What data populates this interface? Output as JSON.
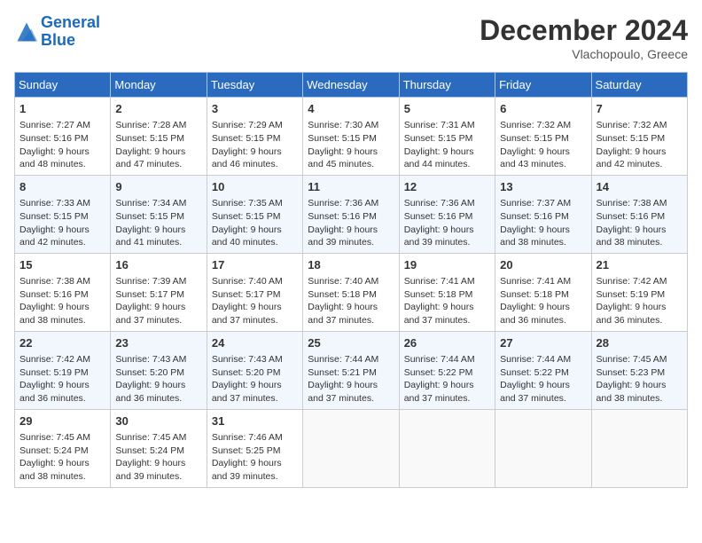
{
  "header": {
    "logo_line1": "General",
    "logo_line2": "Blue",
    "month": "December 2024",
    "location": "Vlachopoulo, Greece"
  },
  "weekdays": [
    "Sunday",
    "Monday",
    "Tuesday",
    "Wednesday",
    "Thursday",
    "Friday",
    "Saturday"
  ],
  "weeks": [
    [
      {
        "day": "1",
        "lines": [
          "Sunrise: 7:27 AM",
          "Sunset: 5:16 PM",
          "Daylight: 9 hours",
          "and 48 minutes."
        ]
      },
      {
        "day": "2",
        "lines": [
          "Sunrise: 7:28 AM",
          "Sunset: 5:15 PM",
          "Daylight: 9 hours",
          "and 47 minutes."
        ]
      },
      {
        "day": "3",
        "lines": [
          "Sunrise: 7:29 AM",
          "Sunset: 5:15 PM",
          "Daylight: 9 hours",
          "and 46 minutes."
        ]
      },
      {
        "day": "4",
        "lines": [
          "Sunrise: 7:30 AM",
          "Sunset: 5:15 PM",
          "Daylight: 9 hours",
          "and 45 minutes."
        ]
      },
      {
        "day": "5",
        "lines": [
          "Sunrise: 7:31 AM",
          "Sunset: 5:15 PM",
          "Daylight: 9 hours",
          "and 44 minutes."
        ]
      },
      {
        "day": "6",
        "lines": [
          "Sunrise: 7:32 AM",
          "Sunset: 5:15 PM",
          "Daylight: 9 hours",
          "and 43 minutes."
        ]
      },
      {
        "day": "7",
        "lines": [
          "Sunrise: 7:32 AM",
          "Sunset: 5:15 PM",
          "Daylight: 9 hours",
          "and 42 minutes."
        ]
      }
    ],
    [
      {
        "day": "8",
        "lines": [
          "Sunrise: 7:33 AM",
          "Sunset: 5:15 PM",
          "Daylight: 9 hours",
          "and 42 minutes."
        ]
      },
      {
        "day": "9",
        "lines": [
          "Sunrise: 7:34 AM",
          "Sunset: 5:15 PM",
          "Daylight: 9 hours",
          "and 41 minutes."
        ]
      },
      {
        "day": "10",
        "lines": [
          "Sunrise: 7:35 AM",
          "Sunset: 5:15 PM",
          "Daylight: 9 hours",
          "and 40 minutes."
        ]
      },
      {
        "day": "11",
        "lines": [
          "Sunrise: 7:36 AM",
          "Sunset: 5:16 PM",
          "Daylight: 9 hours",
          "and 39 minutes."
        ]
      },
      {
        "day": "12",
        "lines": [
          "Sunrise: 7:36 AM",
          "Sunset: 5:16 PM",
          "Daylight: 9 hours",
          "and 39 minutes."
        ]
      },
      {
        "day": "13",
        "lines": [
          "Sunrise: 7:37 AM",
          "Sunset: 5:16 PM",
          "Daylight: 9 hours",
          "and 38 minutes."
        ]
      },
      {
        "day": "14",
        "lines": [
          "Sunrise: 7:38 AM",
          "Sunset: 5:16 PM",
          "Daylight: 9 hours",
          "and 38 minutes."
        ]
      }
    ],
    [
      {
        "day": "15",
        "lines": [
          "Sunrise: 7:38 AM",
          "Sunset: 5:16 PM",
          "Daylight: 9 hours",
          "and 38 minutes."
        ]
      },
      {
        "day": "16",
        "lines": [
          "Sunrise: 7:39 AM",
          "Sunset: 5:17 PM",
          "Daylight: 9 hours",
          "and 37 minutes."
        ]
      },
      {
        "day": "17",
        "lines": [
          "Sunrise: 7:40 AM",
          "Sunset: 5:17 PM",
          "Daylight: 9 hours",
          "and 37 minutes."
        ]
      },
      {
        "day": "18",
        "lines": [
          "Sunrise: 7:40 AM",
          "Sunset: 5:18 PM",
          "Daylight: 9 hours",
          "and 37 minutes."
        ]
      },
      {
        "day": "19",
        "lines": [
          "Sunrise: 7:41 AM",
          "Sunset: 5:18 PM",
          "Daylight: 9 hours",
          "and 37 minutes."
        ]
      },
      {
        "day": "20",
        "lines": [
          "Sunrise: 7:41 AM",
          "Sunset: 5:18 PM",
          "Daylight: 9 hours",
          "and 36 minutes."
        ]
      },
      {
        "day": "21",
        "lines": [
          "Sunrise: 7:42 AM",
          "Sunset: 5:19 PM",
          "Daylight: 9 hours",
          "and 36 minutes."
        ]
      }
    ],
    [
      {
        "day": "22",
        "lines": [
          "Sunrise: 7:42 AM",
          "Sunset: 5:19 PM",
          "Daylight: 9 hours",
          "and 36 minutes."
        ]
      },
      {
        "day": "23",
        "lines": [
          "Sunrise: 7:43 AM",
          "Sunset: 5:20 PM",
          "Daylight: 9 hours",
          "and 36 minutes."
        ]
      },
      {
        "day": "24",
        "lines": [
          "Sunrise: 7:43 AM",
          "Sunset: 5:20 PM",
          "Daylight: 9 hours",
          "and 37 minutes."
        ]
      },
      {
        "day": "25",
        "lines": [
          "Sunrise: 7:44 AM",
          "Sunset: 5:21 PM",
          "Daylight: 9 hours",
          "and 37 minutes."
        ]
      },
      {
        "day": "26",
        "lines": [
          "Sunrise: 7:44 AM",
          "Sunset: 5:22 PM",
          "Daylight: 9 hours",
          "and 37 minutes."
        ]
      },
      {
        "day": "27",
        "lines": [
          "Sunrise: 7:44 AM",
          "Sunset: 5:22 PM",
          "Daylight: 9 hours",
          "and 37 minutes."
        ]
      },
      {
        "day": "28",
        "lines": [
          "Sunrise: 7:45 AM",
          "Sunset: 5:23 PM",
          "Daylight: 9 hours",
          "and 38 minutes."
        ]
      }
    ],
    [
      {
        "day": "29",
        "lines": [
          "Sunrise: 7:45 AM",
          "Sunset: 5:24 PM",
          "Daylight: 9 hours",
          "and 38 minutes."
        ]
      },
      {
        "day": "30",
        "lines": [
          "Sunrise: 7:45 AM",
          "Sunset: 5:24 PM",
          "Daylight: 9 hours",
          "and 39 minutes."
        ]
      },
      {
        "day": "31",
        "lines": [
          "Sunrise: 7:46 AM",
          "Sunset: 5:25 PM",
          "Daylight: 9 hours",
          "and 39 minutes."
        ]
      },
      null,
      null,
      null,
      null
    ]
  ]
}
